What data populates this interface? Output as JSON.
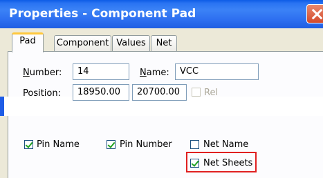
{
  "window": {
    "title": "Properties - Component Pad"
  },
  "tabs": [
    {
      "label": "Pad",
      "active": true
    },
    {
      "label": "Component",
      "active": false
    },
    {
      "label": "Values",
      "active": false
    },
    {
      "label": "Net",
      "active": false
    }
  ],
  "fields": {
    "number_label": "Number:",
    "number_value": "14",
    "name_label": "Name:",
    "name_value": "VCC",
    "position_label": "Position:",
    "position_x": "18950.00",
    "position_y": "20700.00",
    "rel_label": "Rel"
  },
  "checkboxes": {
    "pin_name": {
      "label": "Pin Name",
      "checked": true
    },
    "pin_number": {
      "label": "Pin Number",
      "checked": true
    },
    "net_name": {
      "label": "Net Name",
      "checked": false
    },
    "net_sheets": {
      "label": "Net Sheets",
      "checked": true
    }
  },
  "colors": {
    "title_bar": "#2d6ff0",
    "highlight": "#e02020",
    "tab_accent": "#ffc83c"
  }
}
